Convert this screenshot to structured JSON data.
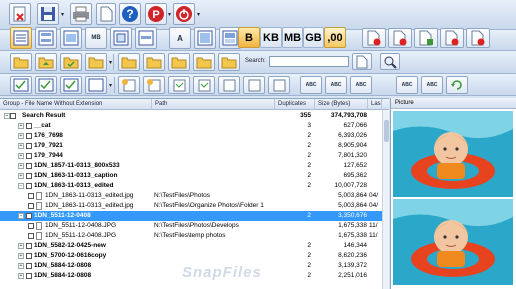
{
  "toolbar": {
    "units": [
      "B",
      "KB",
      "MB",
      "GB",
      ",00"
    ],
    "search_label": "Search:",
    "search_value": "",
    "small_button_text": {
      "mb": "MB",
      "a": "A",
      "abc": "ABC"
    }
  },
  "grid": {
    "columns": [
      "Group - File Name Without Extension",
      "Path",
      "Duplicates",
      "Size (Bytes)",
      "Las"
    ],
    "rows": [
      {
        "name": "Search Result",
        "path": "",
        "dup": "355",
        "size": "374,793,708",
        "last": "",
        "type": "root"
      },
      {
        "name": "__cat",
        "path": "",
        "dup": "3",
        "size": "627,066",
        "last": "",
        "type": "group"
      },
      {
        "name": "176_7698",
        "path": "",
        "dup": "2",
        "size": "6,393,026",
        "last": "",
        "type": "group"
      },
      {
        "name": "179_7921",
        "path": "",
        "dup": "2",
        "size": "8,905,904",
        "last": "",
        "type": "group"
      },
      {
        "name": "179_7944",
        "path": "",
        "dup": "2",
        "size": "7,801,320",
        "last": "",
        "type": "group"
      },
      {
        "name": "1DN_1857-11-0313_800x533",
        "path": "",
        "dup": "2",
        "size": "127,652",
        "last": "",
        "type": "group"
      },
      {
        "name": "1DN_1863-11-0313_caption",
        "path": "",
        "dup": "2",
        "size": "695,362",
        "last": "",
        "type": "group"
      },
      {
        "name": "1DN_1863-11-0313_edited",
        "path": "",
        "dup": "2",
        "size": "10,007,728",
        "last": "",
        "type": "group-open"
      },
      {
        "name": "1DN_1863-11-0313_edited.jpg",
        "path": "N:\\TestFiles\\Photos",
        "dup": "",
        "size": "5,003,864",
        "last": "04/",
        "type": "file"
      },
      {
        "name": "1DN_1863-11-0313_edited.jpg",
        "path": "N:\\TestFiles\\Organize Photos\\Folder 1",
        "dup": "",
        "size": "5,003,864",
        "last": "04/",
        "type": "file"
      },
      {
        "name": "1DN_5511-12-0408",
        "path": "",
        "dup": "2",
        "size": "3,350,676",
        "last": "",
        "type": "selected"
      },
      {
        "name": "1DN_5511-12-0408.JPG",
        "path": "N:\\TestFiles\\Photos\\Develops",
        "dup": "",
        "size": "1,675,338",
        "last": "11/",
        "type": "file"
      },
      {
        "name": "1DN_5511-12-0408.JPG",
        "path": "N:\\TestFiles\\temp photos",
        "dup": "",
        "size": "1,675,338",
        "last": "11/",
        "type": "file"
      },
      {
        "name": "1DN_5582-12-0425-new",
        "path": "",
        "dup": "2",
        "size": "146,344",
        "last": "",
        "type": "group"
      },
      {
        "name": "1DN_5700-12-0616copy",
        "path": "",
        "dup": "2",
        "size": "8,620,236",
        "last": "",
        "type": "group"
      },
      {
        "name": "1DN_5884-12-0808",
        "path": "",
        "dup": "2",
        "size": "3,139,372",
        "last": "",
        "type": "group"
      },
      {
        "name": "1DN_5884-12-0808",
        "path": "",
        "dup": "2",
        "size": "2,251,016",
        "last": "",
        "type": "group"
      }
    ]
  },
  "preview": {
    "header": "Picture"
  },
  "watermark": "SnapFiles"
}
